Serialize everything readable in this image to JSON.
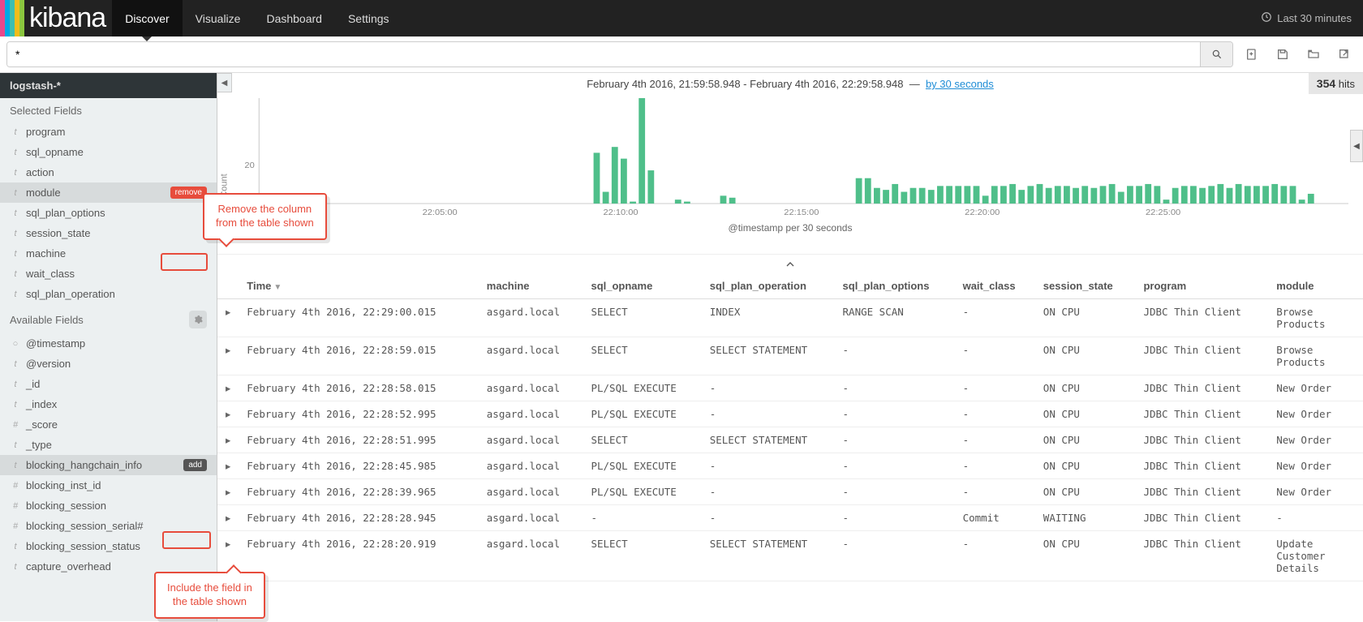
{
  "brand": {
    "name": "kibana",
    "stripe_colors": [
      "#e8488b",
      "#00a9e5",
      "#3ebeb0",
      "#f2bd1a",
      "#8bc63e"
    ]
  },
  "nav": {
    "items": [
      "Discover",
      "Visualize",
      "Dashboard",
      "Settings"
    ],
    "active": 0,
    "time_label": "Last 30 minutes"
  },
  "search": {
    "value": "*",
    "placeholder": ""
  },
  "hits": {
    "count": "354",
    "label": "hits"
  },
  "index_pattern": "logstash-*",
  "sidebar": {
    "selected_title": "Selected Fields",
    "available_title": "Available Fields",
    "selected": [
      {
        "type": "t",
        "name": "program"
      },
      {
        "type": "t",
        "name": "sql_opname"
      },
      {
        "type": "t",
        "name": "action"
      },
      {
        "type": "t",
        "name": "module",
        "hover": "remove"
      },
      {
        "type": "t",
        "name": "sql_plan_options"
      },
      {
        "type": "t",
        "name": "session_state"
      },
      {
        "type": "t",
        "name": "machine"
      },
      {
        "type": "t",
        "name": "wait_class"
      },
      {
        "type": "t",
        "name": "sql_plan_operation"
      }
    ],
    "available": [
      {
        "type": "○",
        "name": "@timestamp"
      },
      {
        "type": "t",
        "name": "@version"
      },
      {
        "type": "t",
        "name": "_id"
      },
      {
        "type": "t",
        "name": "_index"
      },
      {
        "type": "#",
        "name": "_score"
      },
      {
        "type": "t",
        "name": "_type"
      },
      {
        "type": "t",
        "name": "blocking_hangchain_info",
        "hover": "add"
      },
      {
        "type": "#",
        "name": "blocking_inst_id"
      },
      {
        "type": "#",
        "name": "blocking_session"
      },
      {
        "type": "#",
        "name": "blocking_session_serial#"
      },
      {
        "type": "t",
        "name": "blocking_session_status"
      },
      {
        "type": "t",
        "name": "capture_overhead"
      }
    ]
  },
  "time_range": {
    "from": "February 4th 2016, 21:59:58.948",
    "to": "February 4th 2016, 22:29:58.948",
    "by_label": "by 30 seconds"
  },
  "chart_data": {
    "type": "bar",
    "ylabel": "Count",
    "xlabel": "@timestamp per 30 seconds",
    "y_ticks": [
      0,
      20
    ],
    "x_ticks": [
      "22:05:00",
      "22:10:00",
      "22:15:00",
      "22:20:00",
      "22:25:00"
    ],
    "x_range_seconds": [
      0,
      1800
    ],
    "bars": [
      {
        "t": 555,
        "v": 26
      },
      {
        "t": 570,
        "v": 6
      },
      {
        "t": 585,
        "v": 29
      },
      {
        "t": 600,
        "v": 23
      },
      {
        "t": 615,
        "v": 1
      },
      {
        "t": 630,
        "v": 54
      },
      {
        "t": 645,
        "v": 17
      },
      {
        "t": 690,
        "v": 2
      },
      {
        "t": 705,
        "v": 1
      },
      {
        "t": 765,
        "v": 4
      },
      {
        "t": 780,
        "v": 3
      },
      {
        "t": 990,
        "v": 13
      },
      {
        "t": 1005,
        "v": 13
      },
      {
        "t": 1020,
        "v": 8
      },
      {
        "t": 1035,
        "v": 7
      },
      {
        "t": 1050,
        "v": 10
      },
      {
        "t": 1065,
        "v": 6
      },
      {
        "t": 1080,
        "v": 8
      },
      {
        "t": 1095,
        "v": 8
      },
      {
        "t": 1110,
        "v": 7
      },
      {
        "t": 1125,
        "v": 9
      },
      {
        "t": 1140,
        "v": 9
      },
      {
        "t": 1155,
        "v": 9
      },
      {
        "t": 1170,
        "v": 9
      },
      {
        "t": 1185,
        "v": 9
      },
      {
        "t": 1200,
        "v": 4
      },
      {
        "t": 1215,
        "v": 9
      },
      {
        "t": 1230,
        "v": 9
      },
      {
        "t": 1245,
        "v": 10
      },
      {
        "t": 1260,
        "v": 7
      },
      {
        "t": 1275,
        "v": 9
      },
      {
        "t": 1290,
        "v": 10
      },
      {
        "t": 1305,
        "v": 8
      },
      {
        "t": 1320,
        "v": 9
      },
      {
        "t": 1335,
        "v": 9
      },
      {
        "t": 1350,
        "v": 8
      },
      {
        "t": 1365,
        "v": 9
      },
      {
        "t": 1380,
        "v": 8
      },
      {
        "t": 1395,
        "v": 9
      },
      {
        "t": 1410,
        "v": 10
      },
      {
        "t": 1425,
        "v": 6
      },
      {
        "t": 1440,
        "v": 9
      },
      {
        "t": 1455,
        "v": 9
      },
      {
        "t": 1470,
        "v": 10
      },
      {
        "t": 1485,
        "v": 9
      },
      {
        "t": 1500,
        "v": 2
      },
      {
        "t": 1515,
        "v": 8
      },
      {
        "t": 1530,
        "v": 9
      },
      {
        "t": 1545,
        "v": 9
      },
      {
        "t": 1560,
        "v": 8
      },
      {
        "t": 1575,
        "v": 9
      },
      {
        "t": 1590,
        "v": 10
      },
      {
        "t": 1605,
        "v": 8
      },
      {
        "t": 1620,
        "v": 10
      },
      {
        "t": 1635,
        "v": 9
      },
      {
        "t": 1650,
        "v": 9
      },
      {
        "t": 1665,
        "v": 9
      },
      {
        "t": 1680,
        "v": 10
      },
      {
        "t": 1695,
        "v": 9
      },
      {
        "t": 1710,
        "v": 9
      },
      {
        "t": 1725,
        "v": 2
      },
      {
        "t": 1740,
        "v": 5
      }
    ]
  },
  "table": {
    "columns": [
      "Time",
      "machine",
      "sql_opname",
      "sql_plan_operation",
      "sql_plan_options",
      "wait_class",
      "session_state",
      "program",
      "module"
    ],
    "sort_col": 0,
    "sort_dir": "desc",
    "rows": [
      [
        "February 4th 2016, 22:29:00.015",
        "asgard.local",
        "SELECT",
        "INDEX",
        "RANGE SCAN",
        "-",
        "ON CPU",
        "JDBC Thin Client",
        "Browse Products"
      ],
      [
        "February 4th 2016, 22:28:59.015",
        "asgard.local",
        "SELECT",
        "SELECT STATEMENT",
        "-",
        "-",
        "ON CPU",
        "JDBC Thin Client",
        "Browse Products"
      ],
      [
        "February 4th 2016, 22:28:58.015",
        "asgard.local",
        "PL/SQL EXECUTE",
        "-",
        "-",
        "-",
        "ON CPU",
        "JDBC Thin Client",
        "New Order"
      ],
      [
        "February 4th 2016, 22:28:52.995",
        "asgard.local",
        "PL/SQL EXECUTE",
        "-",
        "-",
        "-",
        "ON CPU",
        "JDBC Thin Client",
        "New Order"
      ],
      [
        "February 4th 2016, 22:28:51.995",
        "asgard.local",
        "SELECT",
        "SELECT STATEMENT",
        "-",
        "-",
        "ON CPU",
        "JDBC Thin Client",
        "New Order"
      ],
      [
        "February 4th 2016, 22:28:45.985",
        "asgard.local",
        "PL/SQL EXECUTE",
        "-",
        "-",
        "-",
        "ON CPU",
        "JDBC Thin Client",
        "New Order"
      ],
      [
        "February 4th 2016, 22:28:39.965",
        "asgard.local",
        "PL/SQL EXECUTE",
        "-",
        "-",
        "-",
        "ON CPU",
        "JDBC Thin Client",
        "New Order"
      ],
      [
        "February 4th 2016, 22:28:28.945",
        "asgard.local",
        "-",
        "-",
        "-",
        "Commit",
        "WAITING",
        "JDBC Thin Client",
        "-"
      ],
      [
        "February 4th 2016, 22:28:20.919",
        "asgard.local",
        "SELECT",
        "SELECT STATEMENT",
        "-",
        "-",
        "ON CPU",
        "JDBC Thin Client",
        "Update Customer Details"
      ]
    ]
  },
  "callouts": {
    "remove_l1": "Remove the column",
    "remove_l2": "from the table shown",
    "add_l1": "Include the field in",
    "add_l2": "the table shown"
  },
  "badges": {
    "remove": "remove",
    "add": "add"
  }
}
